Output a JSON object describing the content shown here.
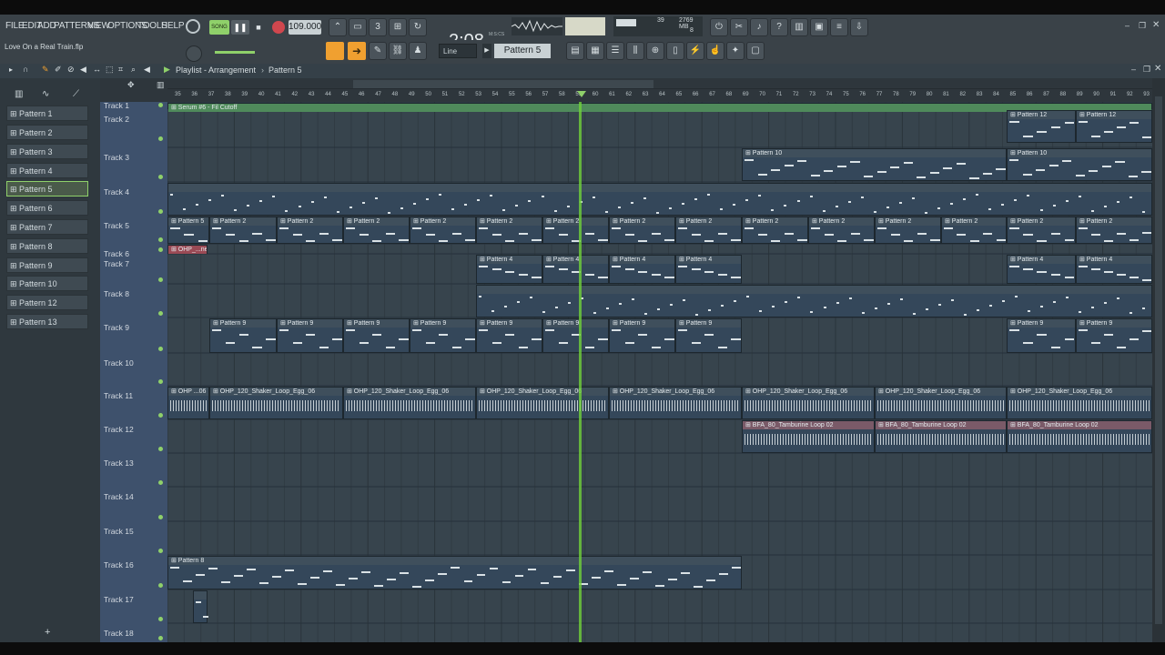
{
  "menu": [
    "FILE",
    "EDIT",
    "ADD",
    "PATTERNS",
    "VIEW",
    "OPTIONS",
    "TOOLS",
    "HELP"
  ],
  "transport": {
    "song_label": "SONG",
    "tempo": "109.000",
    "time": "2:08",
    "time_sub": "64",
    "time_unit": "M:S:CS"
  },
  "cpu": {
    "value": "39",
    "memory": "2769 MB",
    "voices": "8"
  },
  "project_file": "Love On a Real Train.flp",
  "snap": "Line",
  "pattern_selector": "Pattern 5",
  "playlist": {
    "title": "Playlist - Arrangement",
    "current_pattern": "Pattern 5"
  },
  "patterns": [
    "Pattern 1",
    "Pattern 2",
    "Pattern 3",
    "Pattern 4",
    "Pattern 5",
    "Pattern 6",
    "Pattern 7",
    "Pattern 8",
    "Pattern 9",
    "Pattern 10",
    "Pattern 12",
    "Pattern 13"
  ],
  "ruler_numbers": [
    "35",
    "36",
    "37",
    "38",
    "39",
    "40",
    "41",
    "42",
    "43",
    "44",
    "45",
    "46",
    "47",
    "48",
    "49",
    "50",
    "51",
    "52",
    "53",
    "54",
    "55",
    "56",
    "57",
    "58",
    "59",
    "60",
    "61",
    "62",
    "63",
    "64",
    "65",
    "66",
    "67",
    "68",
    "69",
    "70",
    "71",
    "72",
    "73",
    "74",
    "75",
    "76",
    "77",
    "78",
    "79",
    "80",
    "81",
    "82",
    "83",
    "84",
    "85",
    "86",
    "87",
    "88",
    "89",
    "90",
    "91",
    "92",
    "93"
  ],
  "tracks": [
    "Track 1",
    "Track 2",
    "Track 3",
    "Track 4",
    "Track 5",
    "Track 6",
    "Track 7",
    "Track 8",
    "Track 9",
    "Track 10",
    "Track 11",
    "Track 12",
    "Track 13",
    "Track 14",
    "Track 15",
    "Track 16",
    "Track 17",
    "Track 18"
  ],
  "clips": [
    {
      "track": 0,
      "start": 0,
      "end": 1082,
      "label": "Serum #6 - Fil Cutoff",
      "color": "#4f8a5b"
    },
    {
      "track": 1,
      "start": 922,
      "end": 998,
      "label": "Pattern 12",
      "color": "#3f4f5c"
    },
    {
      "track": 1,
      "start": 998,
      "end": 1082,
      "label": "Pattern 12",
      "color": "#3f4f5c"
    },
    {
      "track": 2,
      "start": 631,
      "end": 922,
      "label": "Pattern 10",
      "color": "#3f4f5c"
    },
    {
      "track": 2,
      "start": 922,
      "end": 1082,
      "label": "Pattern 10",
      "color": "#3f4f5c"
    },
    {
      "track": 3,
      "start": 0,
      "end": 1082,
      "label": "",
      "color": "#3f4f5c"
    },
    {
      "track": 4,
      "start": 0,
      "end": 46,
      "label": "Pattern 5",
      "color": "#3f4f5c"
    },
    {
      "track": 4,
      "start": 46,
      "end": 120,
      "label": "Pattern 2",
      "color": "#3f4f5c"
    },
    {
      "track": 4,
      "start": 120,
      "end": 193,
      "label": "Pattern 2",
      "color": "#3f4f5c"
    },
    {
      "track": 4,
      "start": 193,
      "end": 266,
      "label": "Pattern 2",
      "color": "#3f4f5c"
    },
    {
      "track": 4,
      "start": 266,
      "end": 339,
      "label": "Pattern 2",
      "color": "#3f4f5c"
    },
    {
      "track": 4,
      "start": 339,
      "end": 412,
      "label": "Pattern 2",
      "color": "#3f4f5c"
    },
    {
      "track": 4,
      "start": 412,
      "end": 485,
      "label": "Pattern 2",
      "color": "#3f4f5c"
    },
    {
      "track": 4,
      "start": 485,
      "end": 558,
      "label": "Pattern 2",
      "color": "#3f4f5c"
    },
    {
      "track": 4,
      "start": 558,
      "end": 631,
      "label": "Pattern 2",
      "color": "#3f4f5c"
    },
    {
      "track": 4,
      "start": 631,
      "end": 704,
      "label": "Pattern 2",
      "color": "#3f4f5c"
    },
    {
      "track": 4,
      "start": 704,
      "end": 777,
      "label": "Pattern 2",
      "color": "#3f4f5c"
    },
    {
      "track": 4,
      "start": 777,
      "end": 850,
      "label": "Pattern 2",
      "color": "#3f4f5c"
    },
    {
      "track": 4,
      "start": 850,
      "end": 922,
      "label": "Pattern 2",
      "color": "#3f4f5c"
    },
    {
      "track": 4,
      "start": 922,
      "end": 998,
      "label": "Pattern 2",
      "color": "#3f4f5c"
    },
    {
      "track": 4,
      "start": 998,
      "end": 1082,
      "label": "Pattern 2",
      "color": "#3f4f5c"
    },
    {
      "track": 5,
      "start": 0,
      "end": 44,
      "label": "OHP_...ne",
      "color": "#9a4a55"
    },
    {
      "track": 6,
      "start": 339,
      "end": 412,
      "label": "Pattern 4",
      "color": "#3f4f5c"
    },
    {
      "track": 6,
      "start": 412,
      "end": 485,
      "label": "Pattern 4",
      "color": "#3f4f5c"
    },
    {
      "track": 6,
      "start": 485,
      "end": 558,
      "label": "Pattern 4",
      "color": "#3f4f5c"
    },
    {
      "track": 6,
      "start": 558,
      "end": 631,
      "label": "Pattern 4",
      "color": "#3f4f5c"
    },
    {
      "track": 6,
      "start": 922,
      "end": 998,
      "label": "Pattern 4",
      "color": "#3f4f5c"
    },
    {
      "track": 6,
      "start": 998,
      "end": 1082,
      "label": "Pattern 4",
      "color": "#3f4f5c"
    },
    {
      "track": 7,
      "start": 339,
      "end": 1082,
      "label": "",
      "color": "#3f4f5c"
    },
    {
      "track": 8,
      "start": 46,
      "end": 120,
      "label": "Pattern 9",
      "color": "#3f4f5c"
    },
    {
      "track": 8,
      "start": 120,
      "end": 193,
      "label": "Pattern 9",
      "color": "#3f4f5c"
    },
    {
      "track": 8,
      "start": 193,
      "end": 266,
      "label": "Pattern 9",
      "color": "#3f4f5c"
    },
    {
      "track": 8,
      "start": 266,
      "end": 339,
      "label": "Pattern 9",
      "color": "#3f4f5c"
    },
    {
      "track": 8,
      "start": 339,
      "end": 412,
      "label": "Pattern 9",
      "color": "#3f4f5c"
    },
    {
      "track": 8,
      "start": 412,
      "end": 485,
      "label": "Pattern 9",
      "color": "#3f4f5c"
    },
    {
      "track": 8,
      "start": 485,
      "end": 558,
      "label": "Pattern 9",
      "color": "#3f4f5c"
    },
    {
      "track": 8,
      "start": 558,
      "end": 631,
      "label": "Pattern 9",
      "color": "#3f4f5c"
    },
    {
      "track": 8,
      "start": 922,
      "end": 998,
      "label": "Pattern 9",
      "color": "#3f4f5c"
    },
    {
      "track": 8,
      "start": 998,
      "end": 1082,
      "label": "Pattern 9",
      "color": "#3f4f5c"
    },
    {
      "track": 10,
      "start": 0,
      "end": 46,
      "label": "OHP ...06",
      "color": "#3f4f5c"
    },
    {
      "track": 10,
      "start": 46,
      "end": 193,
      "label": "OHP_120_Shaker_Loop_Egg_06",
      "color": "#3f4f5c"
    },
    {
      "track": 10,
      "start": 193,
      "end": 339,
      "label": "OHP_120_Shaker_Loop_Egg_06",
      "color": "#3f4f5c"
    },
    {
      "track": 10,
      "start": 339,
      "end": 485,
      "label": "OHP_120_Shaker_Loop_Egg_06",
      "color": "#3f4f5c"
    },
    {
      "track": 10,
      "start": 485,
      "end": 631,
      "label": "OHP_120_Shaker_Loop_Egg_06",
      "color": "#3f4f5c"
    },
    {
      "track": 10,
      "start": 631,
      "end": 777,
      "label": "OHP_120_Shaker_Loop_Egg_06",
      "color": "#3f4f5c"
    },
    {
      "track": 10,
      "start": 777,
      "end": 922,
      "label": "OHP_120_Shaker_Loop_Egg_06",
      "color": "#3f4f5c"
    },
    {
      "track": 10,
      "start": 922,
      "end": 1082,
      "label": "OHP_120_Shaker_Loop_Egg_06",
      "color": "#3f4f5c"
    },
    {
      "track": 11,
      "start": 631,
      "end": 777,
      "label": "BFA_80_Tamburine Loop 02",
      "color": "#7a5a68"
    },
    {
      "track": 11,
      "start": 777,
      "end": 922,
      "label": "BFA_80_Tamburine Loop 02",
      "color": "#7a5a68"
    },
    {
      "track": 11,
      "start": 922,
      "end": 1082,
      "label": "BFA_80_Tamburine Loop 02",
      "color": "#7a5a68"
    },
    {
      "track": 15,
      "start": 0,
      "end": 631,
      "label": "Pattern 8",
      "color": "#3f4f5c"
    },
    {
      "track": 16,
      "start": 28,
      "end": 44,
      "label": "",
      "color": "#3f4f5c"
    }
  ],
  "colors": {
    "accent": "#f0a030",
    "track_names_bg": "#3e516c",
    "playhead": "#6fcf3a"
  }
}
